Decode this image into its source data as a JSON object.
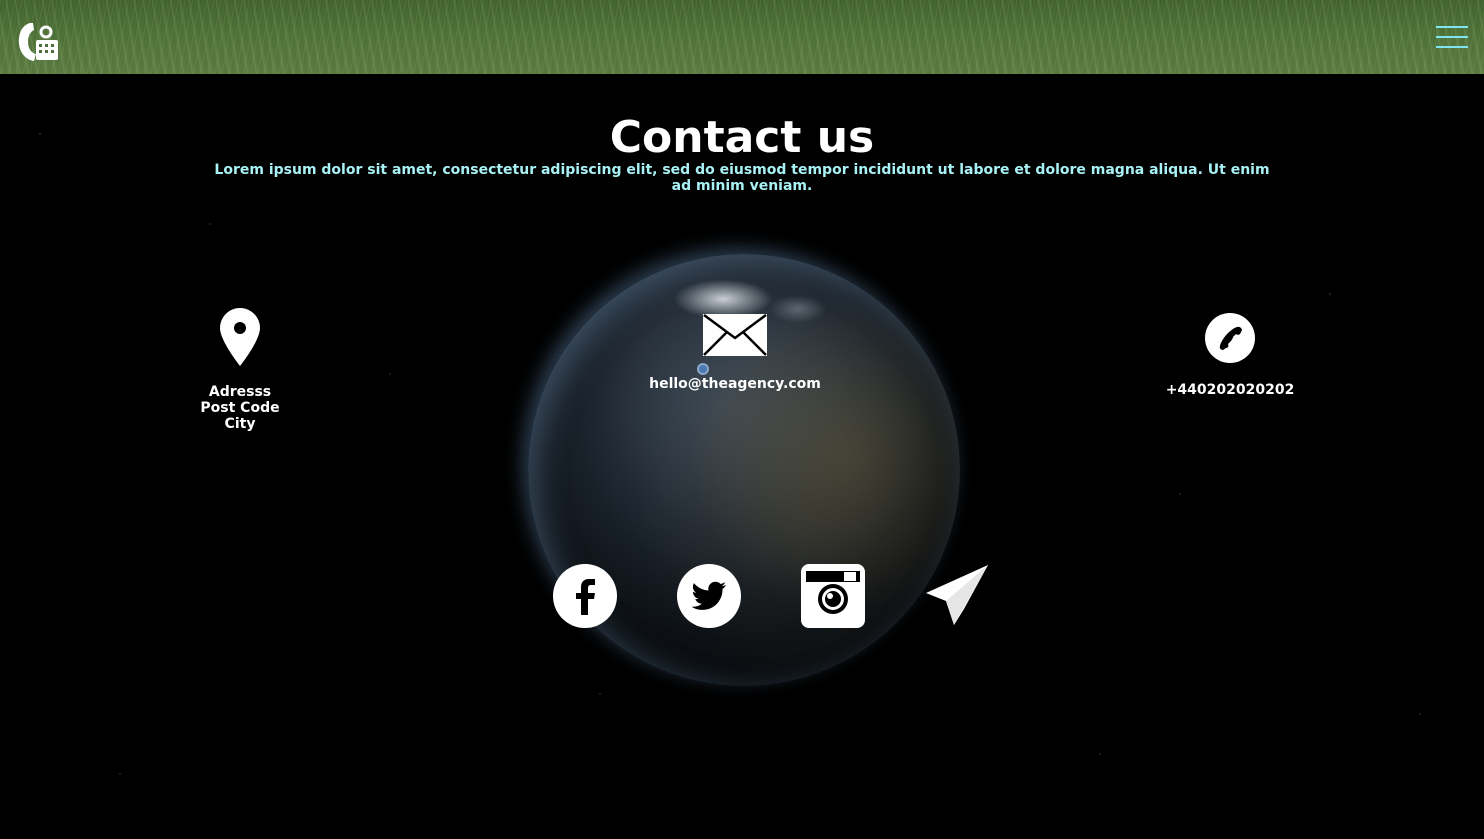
{
  "header": {
    "logo_icon": "phone-keypad-logo-icon",
    "menu_icon": "hamburger-menu-icon",
    "menu_color": "#7fe3f2"
  },
  "main": {
    "title": "Contact us",
    "subtitle": "Lorem ipsum dolor sit amet, consectetur adipiscing elit, sed do eiusmod tempor incididunt ut labore et dolore magna aliqua. Ut enim ad minim veniam.",
    "subtitle_color": "#a8f1f4"
  },
  "contact": {
    "address": {
      "icon": "map-pin-icon",
      "line1": "Adresss",
      "line2": "Post Code",
      "line3": "City"
    },
    "email": {
      "icon": "envelope-icon",
      "value": "hello@theagency.com"
    },
    "phone": {
      "icon": "phone-icon",
      "value": "+440202020202"
    }
  },
  "social": [
    {
      "icon": "facebook-icon"
    },
    {
      "icon": "twitter-icon"
    },
    {
      "icon": "instagram-icon"
    },
    {
      "icon": "paper-plane-icon"
    }
  ]
}
